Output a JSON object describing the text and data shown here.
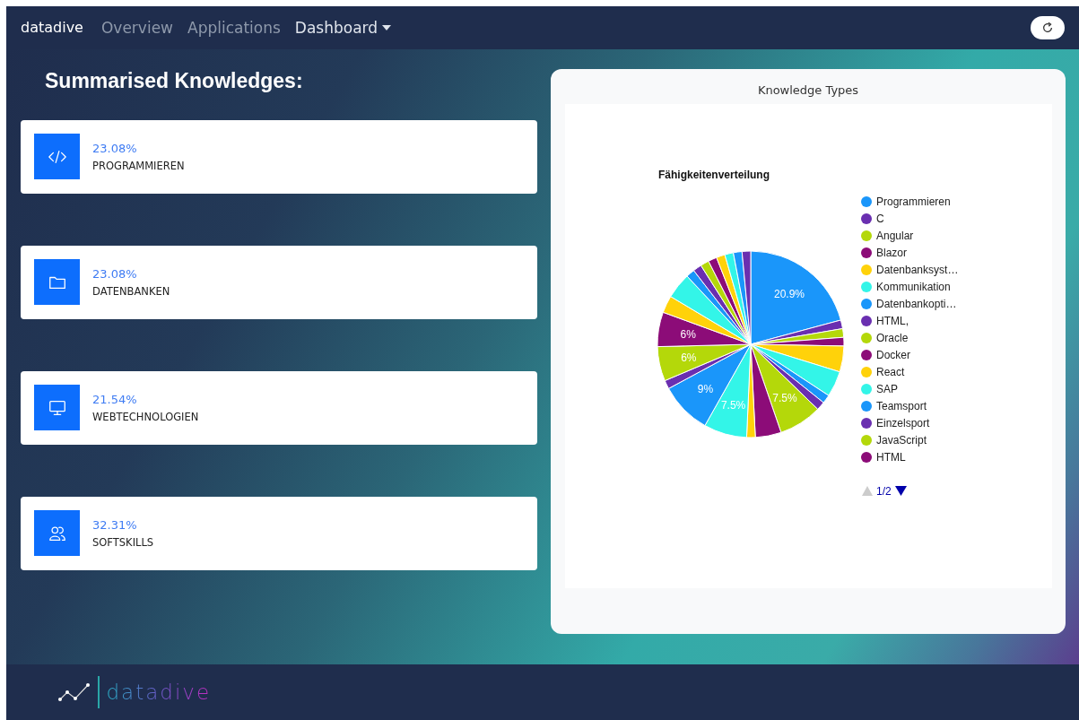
{
  "navbar": {
    "brand": "datadive",
    "links": [
      {
        "label": "Overview",
        "selected": false,
        "has_menu": false
      },
      {
        "label": "Applications",
        "selected": false,
        "has_menu": false
      },
      {
        "label": "Dashboard",
        "selected": true,
        "has_menu": true
      }
    ]
  },
  "heading": "Summarised Knowledges:",
  "stats": [
    {
      "kind": "code",
      "percent": "23.08%",
      "label": "PROGRAMMIEREN"
    },
    {
      "kind": "folder",
      "percent": "23.08%",
      "label": "DATENBANKEN"
    },
    {
      "kind": "monitor",
      "percent": "21.54%",
      "label": "WEBTECHNOLOGIEN"
    },
    {
      "kind": "people",
      "percent": "32.31%",
      "label": "SOFTSKILLS"
    }
  ],
  "panel": {
    "title": "Knowledge Types",
    "chart_data": {
      "type": "pie",
      "title": "Fähigkeitenverteilung",
      "colors": [
        "#1a96fa",
        "#6a2fb0",
        "#b4d80a",
        "#8c0c78",
        "#ffd20a",
        "#33f5e8",
        "#1a96fa",
        "#6a2fb0",
        "#b4d80a",
        "#8c0c78",
        "#ffd20a",
        "#33f5e8",
        "#1a96fa",
        "#6a2fb0",
        "#b4d80a",
        "#8c0c78",
        "#ffd20a",
        "#33f5e8",
        "#1a96fa",
        "#6a2fb0",
        "#b4d80a",
        "#8c0c78",
        "#ffd20a",
        "#33f5e8",
        "#1a96fa",
        "#6a2fb0"
      ],
      "values": [
        20.9,
        1.5,
        1.5,
        1.5,
        4.5,
        4.5,
        1.5,
        1.5,
        7.5,
        4.5,
        1.5,
        7.5,
        9,
        1.5,
        6,
        6,
        3,
        4.5,
        1.5,
        1.5,
        1.5,
        1.5,
        1.5,
        1.5,
        1.5,
        1.5
      ],
      "value_labels": [
        "20.9%",
        null,
        null,
        null,
        null,
        null,
        null,
        null,
        "7.5%",
        null,
        null,
        "7.5%",
        "9%",
        null,
        "6%",
        "6%",
        null,
        null,
        null,
        null,
        null,
        null,
        null,
        null,
        null,
        null
      ]
    },
    "legend": {
      "items": [
        {
          "label": "Programmieren",
          "color": "#1a96fa"
        },
        {
          "label": "C",
          "color": "#6a2fb0"
        },
        {
          "label": "Angular",
          "color": "#b4d80a"
        },
        {
          "label": "Blazor",
          "color": "#8c0c78"
        },
        {
          "label": "Datenbanksyst…",
          "color": "#ffd20a"
        },
        {
          "label": "Kommunikation",
          "color": "#33f5e8"
        },
        {
          "label": "Datenbankopti…",
          "color": "#1a96fa"
        },
        {
          "label": "HTML,",
          "color": "#6a2fb0"
        },
        {
          "label": "Oracle",
          "color": "#b4d80a"
        },
        {
          "label": "Docker",
          "color": "#8c0c78"
        },
        {
          "label": "React",
          "color": "#ffd20a"
        },
        {
          "label": "SAP",
          "color": "#33f5e8"
        },
        {
          "label": "Teamsport",
          "color": "#1a96fa"
        },
        {
          "label": "Einzelsport",
          "color": "#6a2fb0"
        },
        {
          "label": "JavaScript",
          "color": "#b4d80a"
        },
        {
          "label": "HTML",
          "color": "#8c0c78"
        }
      ],
      "page": "1/2",
      "prev_disabled": true,
      "next_disabled": false
    }
  },
  "footer": {
    "logo_text": "datadive"
  }
}
